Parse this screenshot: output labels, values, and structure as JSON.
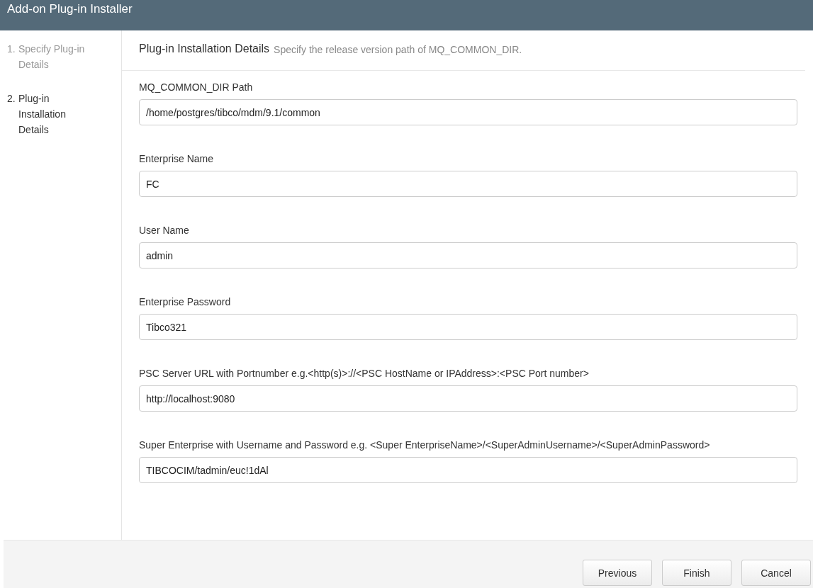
{
  "window": {
    "title": "Add-on Plug-in Installer"
  },
  "steps": [
    {
      "number": "1.",
      "label": "Specify Plug-in Details",
      "selected": false
    },
    {
      "number": "2.",
      "label": "Plug-in Installation Details",
      "selected": true
    }
  ],
  "panel": {
    "title": "Plug-in Installation Details",
    "subtitle": "Specify the release version path of MQ_COMMON_DIR."
  },
  "fields": [
    {
      "label": "MQ_COMMON_DIR Path",
      "value": "/home/postgres/tibco/mdm/9.1/common"
    },
    {
      "label": "Enterprise Name",
      "value": "FC"
    },
    {
      "label": "User Name",
      "value": "admin"
    },
    {
      "label": "Enterprise Password",
      "value": "Tibco321"
    },
    {
      "label": "PSC Server URL with Portnumber e.g.<http(s)>://<PSC HostName or IPAddress>:<PSC Port number>",
      "value": "http://localhost:9080"
    },
    {
      "label": "Super Enterprise with Username and Password e.g. <Super EnterpriseName>/<SuperAdminUsername>/<SuperAdminPassword>",
      "value": "TIBCOCIM/tadmin/euc!1dAl"
    }
  ],
  "buttons": [
    "Previous",
    "Finish",
    "Cancel"
  ]
}
